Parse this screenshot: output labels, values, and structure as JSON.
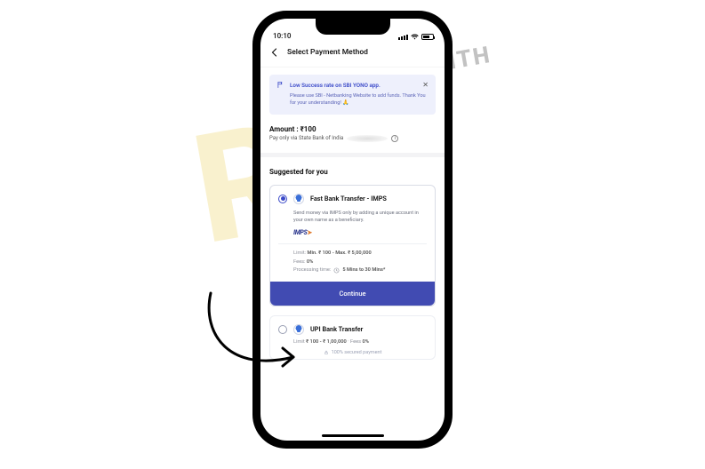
{
  "statusbar": {
    "time": "10:10"
  },
  "header": {
    "title": "Select Payment Method"
  },
  "notice": {
    "title": "Low Success rate on SBI YONO app.",
    "body": "Please use SBI - Netbanking Website to add funds. Thank You for your understanding!",
    "emoji": "🙏"
  },
  "amount": {
    "label": "Amount : ₹100",
    "subtext": "Pay only via State Bank of India"
  },
  "sections": {
    "suggested_title": "Suggested for you"
  },
  "methods": [
    {
      "title": "Fast Bank Transfer - IMPS",
      "desc": "Send money via IMPS only by adding a unique account in your own name as a beneficiary.",
      "logo": "IMPS",
      "limit_label": "Limit:",
      "limit_value": "Min. ₹ 100 - Max. ₹ 5,00,000",
      "fees_label": "Fees:",
      "fees_value": "0%",
      "processing_label": "Processing time:",
      "processing_value": "5 Mins to 30 Mins*",
      "cta": "Continue"
    },
    {
      "title": "UPI Bank Transfer",
      "limit_line_label": "Limit",
      "limit_line_value": "₹ 100 - ₹ 1,00,000",
      "fees_label": "Fees",
      "fees_value": "0%",
      "secure_text": "100% secured payment"
    }
  ],
  "watermark": {
    "big": "Re",
    "small": "WITH"
  }
}
